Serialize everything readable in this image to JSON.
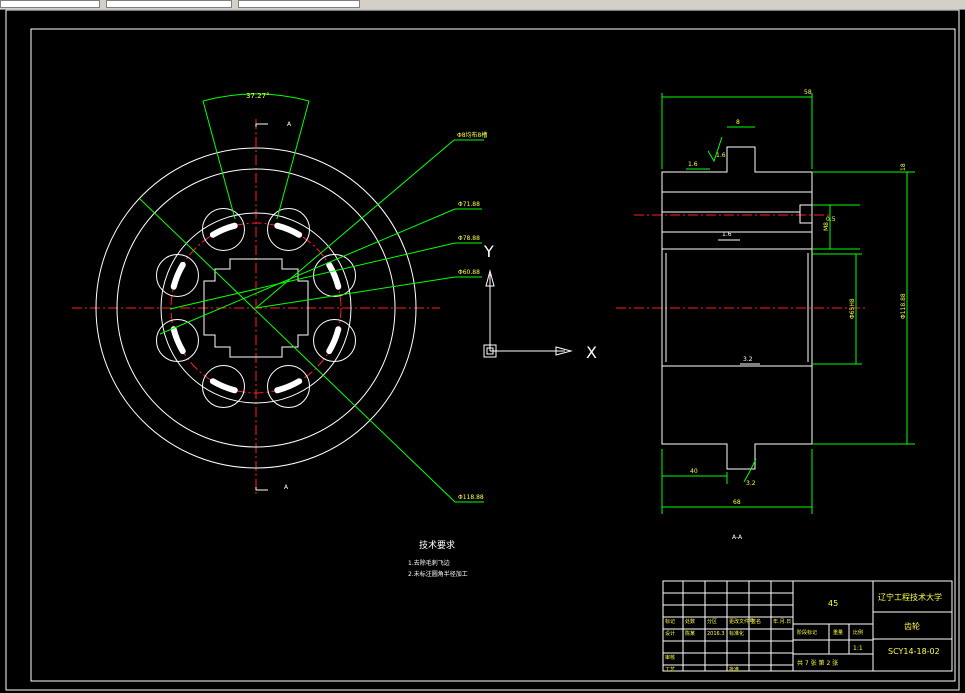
{
  "tech_requirements": {
    "title": "技术要求",
    "items": [
      "1.去除毛刺飞边",
      "2.未标注圆角半径加工"
    ]
  },
  "section_label": "A-A",
  "dims_left": {
    "angle": "37.27°",
    "section_mark_top": "A",
    "section_mark_bottom": "A",
    "leader1": "Φ8均布8槽",
    "leader2": "Φ71.88",
    "leader3": "Φ78.88",
    "leader4": "Φ60.88",
    "leader5": "Φ118.88"
  },
  "dims_right": {
    "top_width": "58",
    "slot": "8",
    "rough1": "1.6",
    "rough2": "1.6",
    "rough3": "1.6",
    "rough4": "3.2",
    "chamfer": "0.5",
    "height": "18",
    "hole": "M8",
    "bore": "Φ65H8",
    "outer": "Φ118.88",
    "bottom1": "40",
    "bottom2": "68"
  },
  "axes": {
    "y_label": "Y",
    "x_label": "X"
  },
  "title_block": {
    "school": "辽宁工程技术大学",
    "material": "45",
    "part_name": "齿轮",
    "drawing_no": "SCY14-18-02",
    "scale": "1:1",
    "sheets": "共 7 张    第 2 张",
    "cells": [
      "标记",
      "处数",
      "分区",
      "更改文件号",
      "签名",
      "年.月.日",
      "设计",
      "陈某",
      "2016.3",
      "标准化",
      "审核",
      "工艺",
      "批准",
      "阶段标记",
      "重量",
      "比例"
    ]
  },
  "colors": {
    "line": "#ffffff",
    "dim": "#00ff00",
    "center": "#ff2020",
    "text": "#ffff40",
    "tab": "#d4d0c8"
  }
}
